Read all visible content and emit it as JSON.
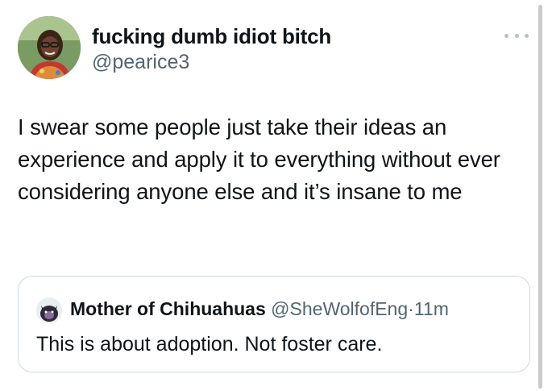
{
  "tweet": {
    "display_name": "fucking dumb idiot bitch",
    "handle": "@pearice3",
    "text": "I swear some people just take their ideas an experience and apply it to everything without ever considering anyone else and it’s insane to me",
    "avatar_icon": "profile-photo",
    "more_icon": "more-horizontal-icon"
  },
  "quote": {
    "display_name": "Mother of Chihuahuas",
    "handle": "@SheWolfofEng",
    "separator": "·",
    "time": "11m",
    "text": "This is about adoption. Not foster care.",
    "avatar_icon": "profile-photo"
  },
  "colors": {
    "text_primary": "#0f1419",
    "text_secondary": "#536471",
    "border": "#cfd9de"
  }
}
